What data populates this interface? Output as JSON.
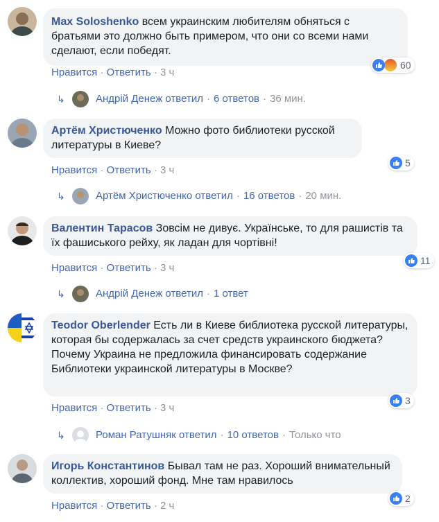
{
  "actions": {
    "like": "Нравится",
    "reply": "Ответить",
    "dot": "·"
  },
  "comments": [
    {
      "author": "Max Soloshenko",
      "text": "всем украинским любителям обняться с братьями это должно быть примером, что они со всеми нами сделают, если победят.",
      "time": "3 ч",
      "reactions": "60",
      "reply_label": "Андрій Денеж ответил",
      "reply_count": "6 ответов",
      "reply_time": "36 мин."
    },
    {
      "author": "Артём Христюченко",
      "text": "Можно фото библиотеки русской литературы в Киеве?",
      "time": "3 ч",
      "reactions": "5",
      "reply_label": "Артём Христюченко ответил",
      "reply_count": "16 ответов",
      "reply_time": "20 мин."
    },
    {
      "author": "Валентин Тарасов",
      "text": "Зовсім не дивує. Українське, то для рашистів та їх фашиського рейху, як ладан для чортівні!",
      "time": "3 ч",
      "reactions": "11",
      "reply_label": "Андрій Денеж ответил",
      "reply_count": "1 ответ",
      "reply_time": ""
    },
    {
      "author": "Teodor Oberlender",
      "text": "Есть ли в Киеве библиотека русской литературы, которая бы содержалась за счет средств украинского бюджета? Почему Украина не предложила финансировать содержание Библиотеки украинской литературы в Москве?",
      "time": "3 ч",
      "reactions": "3",
      "reply_label": "Роман Ратушняк ответил",
      "reply_count": "10 ответов",
      "reply_time": "Только что"
    },
    {
      "author": "Игорь Константинов",
      "text": "Бывал там не раз. Хороший внимательный коллектив, хороший фонд. Мне там нравилось",
      "time": "2 ч",
      "reactions": "2"
    }
  ],
  "colors": {
    "link": "#4267b2",
    "author": "#385898",
    "bubble": "#f2f3f5",
    "muted": "#90949c",
    "like": "#3b7ff5"
  }
}
